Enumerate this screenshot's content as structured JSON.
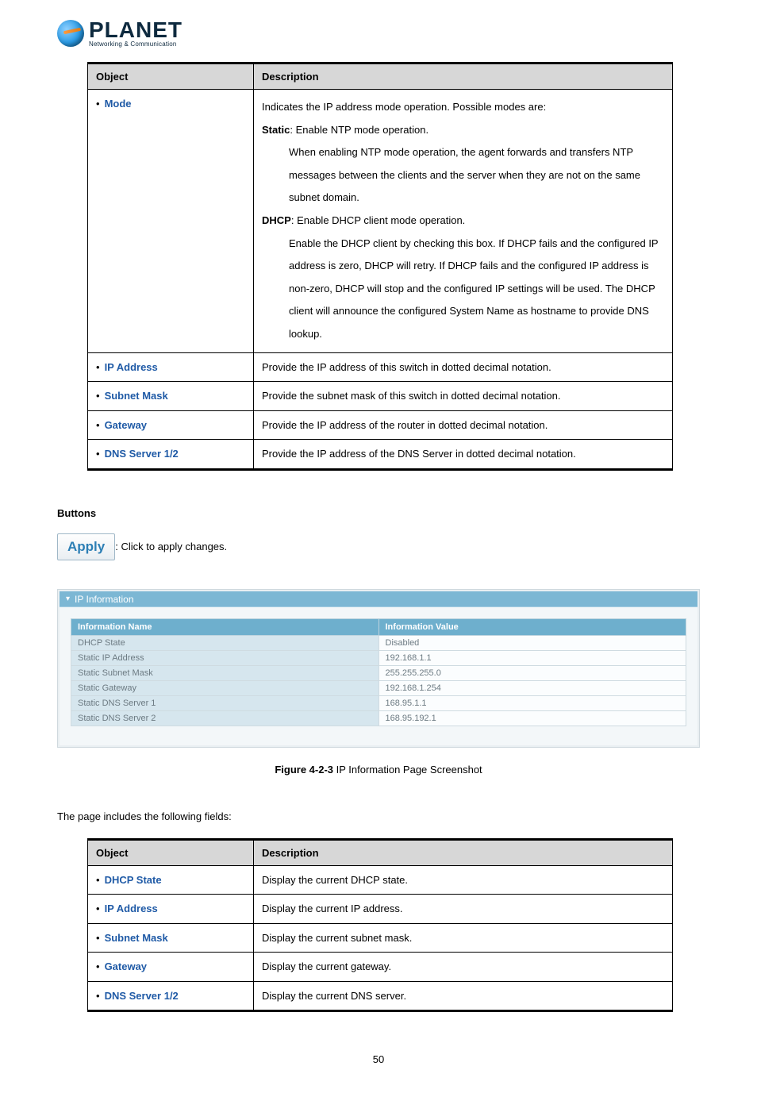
{
  "logo": {
    "brand": "PLANET",
    "tag": "Networking & Communication"
  },
  "table1": {
    "headers": {
      "object": "Object",
      "description": "Description"
    },
    "rows": [
      {
        "object": "Mode",
        "desc": {
          "intro": "Indicates the IP address mode operation. Possible modes are:",
          "static_label": "Static",
          "static_suffix": ": Enable NTP mode operation.",
          "static_detail": "When enabling NTP mode operation, the agent forwards and transfers NTP messages between the clients and the server when they are not on the same subnet domain.",
          "dhcp_label": "DHCP",
          "dhcp_suffix": ": Enable DHCP client mode operation.",
          "dhcp_detail": "Enable the DHCP client by checking this box. If DHCP fails and the configured IP address is zero, DHCP will retry. If DHCP fails and the configured IP address is non-zero, DHCP will stop and the configured IP settings will be used. The DHCP client will announce the configured System Name as hostname to provide DNS lookup."
        }
      },
      {
        "object": "IP Address",
        "desc_text": "Provide the IP address of this switch in dotted decimal notation."
      },
      {
        "object": "Subnet Mask",
        "desc_text": "Provide the subnet mask of this switch in dotted decimal notation."
      },
      {
        "object": "Gateway",
        "desc_text": "Provide the IP address of the router in dotted decimal notation."
      },
      {
        "object": "DNS Server 1/2",
        "desc_text": "Provide the IP address of the DNS Server in dotted decimal notation."
      }
    ]
  },
  "buttons_heading": "Buttons",
  "apply": {
    "label": "Apply",
    "text": ": Click to apply changes."
  },
  "panel": {
    "title": "IP Information",
    "headers": {
      "name": "Information Name",
      "value": "Information Value"
    },
    "rows": [
      {
        "name": "DHCP State",
        "value": "Disabled"
      },
      {
        "name": "Static IP Address",
        "value": "192.168.1.1"
      },
      {
        "name": "Static Subnet Mask",
        "value": "255.255.255.0"
      },
      {
        "name": "Static Gateway",
        "value": "192.168.1.254"
      },
      {
        "name": "Static DNS Server 1",
        "value": "168.95.1.1"
      },
      {
        "name": "Static DNS Server 2",
        "value": "168.95.192.1"
      }
    ]
  },
  "figure": {
    "label": "Figure 4-2-3",
    "text": " IP Information Page Screenshot"
  },
  "intro_line": "The page includes the following fields:",
  "table2": {
    "headers": {
      "object": "Object",
      "description": "Description"
    },
    "rows": [
      {
        "object": "DHCP State",
        "desc_text": "Display the current DHCP state."
      },
      {
        "object": "IP Address",
        "desc_text": "Display the current IP address."
      },
      {
        "object": "Subnet Mask",
        "desc_text": "Display the current subnet mask."
      },
      {
        "object": "Gateway",
        "desc_text": "Display the current gateway."
      },
      {
        "object": "DNS Server 1/2",
        "desc_text": "Display the current DNS server."
      }
    ]
  },
  "page_number": "50",
  "chart_data": {
    "type": "table",
    "title": "IP Information",
    "columns": [
      "Information Name",
      "Information Value"
    ],
    "rows": [
      [
        "DHCP State",
        "Disabled"
      ],
      [
        "Static IP Address",
        "192.168.1.1"
      ],
      [
        "Static Subnet Mask",
        "255.255.255.0"
      ],
      [
        "Static Gateway",
        "192.168.1.254"
      ],
      [
        "Static DNS Server 1",
        "168.95.1.1"
      ],
      [
        "Static DNS Server 2",
        "168.95.192.1"
      ]
    ]
  }
}
